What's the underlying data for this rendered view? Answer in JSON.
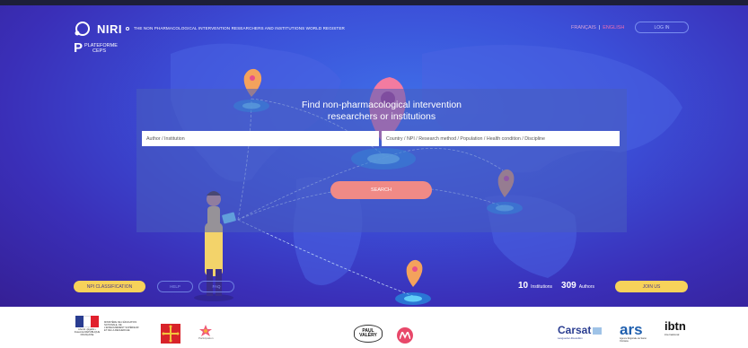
{
  "header": {
    "logo_text": "NIRI",
    "tagline": "THE NON PHARMACOLOGICAL INTERVENTION RESEARCHERS AND INSTITUTIONS WORLD REGISTER",
    "platform_mark": "P",
    "platform_label_1": "PLATEFORME",
    "platform_label_2": "CEPS",
    "lang_fr": "FRANÇAIS",
    "lang_sep": "|",
    "lang_en": "ENGLISH",
    "login_label": "LOG IN"
  },
  "search": {
    "title_line1": "Find non-pharmacological intervention",
    "title_line2": "researchers or institutions",
    "field1_placeholder": "Author / Institution",
    "field2_placeholder": "Country / NPI / Research method / Population / Health condition / Discipline",
    "button_label": "SEARCH"
  },
  "footer_bar": {
    "npi_button": "NPI CLASSIFICATION",
    "help_button": "HELP",
    "faq_button": "FAQ",
    "institutions_count": "10",
    "institutions_label": "Institutions",
    "authors_count": "309",
    "authors_label": "Authors",
    "join_button": "JOIN US"
  },
  "partners": {
    "ministry_text": "MINISTÈRE DE L'ÉDUCATION NATIONALE, DE L'ENSEIGNEMENT SUPÉRIEUR ET DE LA RECHERCHE",
    "ministry_motto": "Liberté • Égalité • Fraternité RÉPUBLIQUE FRANÇAISE",
    "participation_label": "Participation",
    "valery_1": "PAUL",
    "valery_2": "VALÉRY",
    "carsat_label": "Carsat",
    "carsat_sub": "Languedoc-Roussillon",
    "ars_label": "ars",
    "ars_sub": "Agence Régionale de Santé Occitanie",
    "ibtn_label": "ibtn",
    "ibtn_sub": "international"
  },
  "colors": {
    "accent_yellow": "#f7d25a",
    "search_button": "#f08a86",
    "hero_blue": "#3b4fd8",
    "pink_active": "#f06fb2"
  }
}
